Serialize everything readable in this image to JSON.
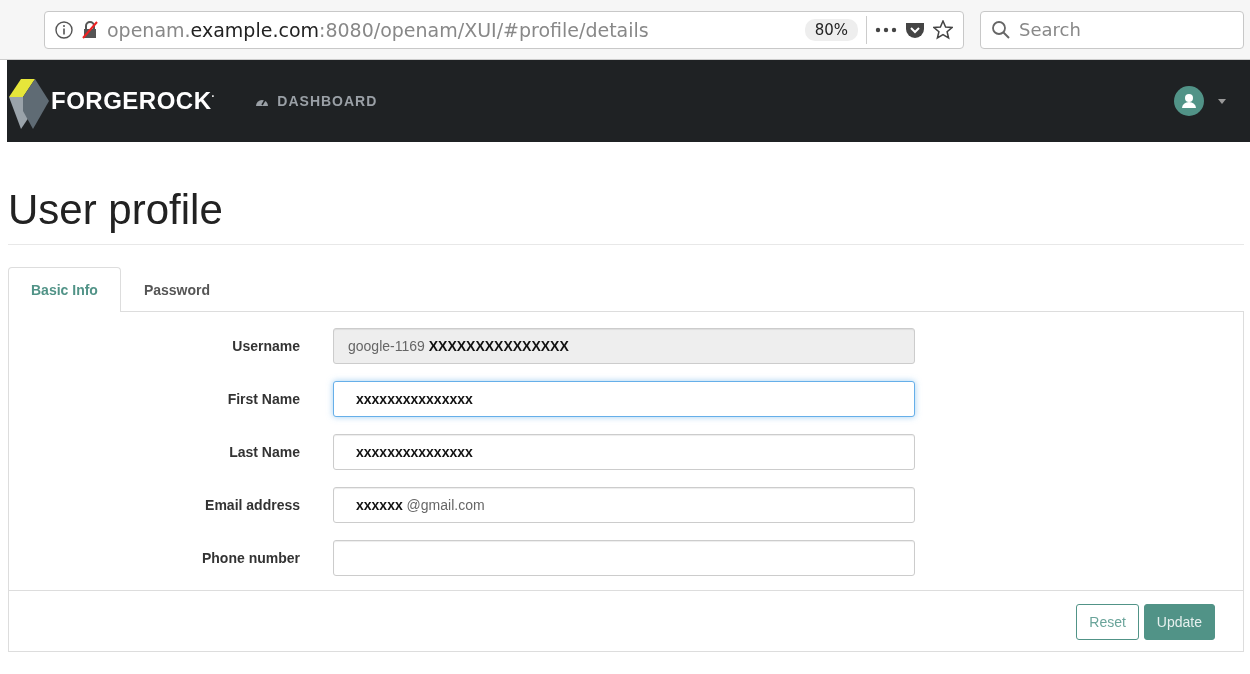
{
  "browser": {
    "url_prefix": "openam.",
    "url_domain": "example.com",
    "url_suffix": ":8080/openam/XUI/#profile/details",
    "zoom": "80%",
    "search_placeholder": "Search"
  },
  "navbar": {
    "brand": "FORGEROCK",
    "brand_mark": "·",
    "items": [
      {
        "label": "DASHBOARD",
        "selected": false
      }
    ]
  },
  "page_title": "User profile",
  "tabs": [
    {
      "label": "Basic Info",
      "selected": true
    },
    {
      "label": "Password",
      "selected": false
    }
  ],
  "fields": [
    {
      "label": "Username",
      "value": "google-1169 **XXXXXXXXXXXXXXX**",
      "disabled": true,
      "focused": false
    },
    {
      "label": "First Name",
      "value": "**xxxxxxxxxxxxxxx**",
      "disabled": false,
      "focused": true
    },
    {
      "label": "Last Name",
      "value": "**xxxxxxxxxxxxxxx**",
      "disabled": false,
      "focused": false
    },
    {
      "label": "Email address",
      "value": "**xxxxxx** @gmail.com",
      "disabled": false,
      "focused": false
    },
    {
      "label": "Phone number",
      "disabled": false,
      "focused": false
    }
  ],
  "buttons": [
    {
      "label": "Reset",
      "kind": "secondary"
    },
    {
      "label": "Update",
      "kind": "primary"
    }
  ]
}
